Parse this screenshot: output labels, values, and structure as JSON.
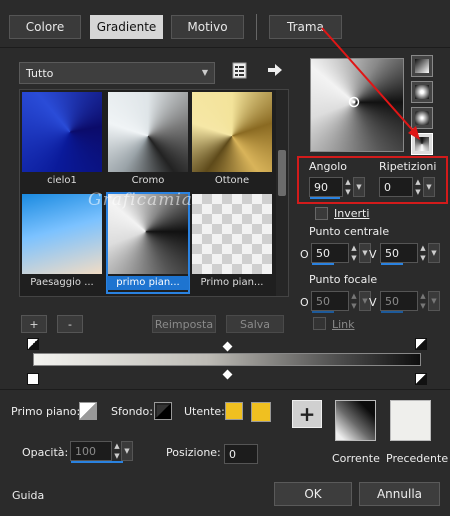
{
  "tabs": [
    {
      "label": "Colore"
    },
    {
      "label": "Gradiente"
    },
    {
      "label": "Motivo"
    },
    {
      "label": "Trama"
    }
  ],
  "dropdown": {
    "value": "Tutto"
  },
  "gradients": [
    {
      "label": "cielo1"
    },
    {
      "label": "Cromo"
    },
    {
      "label": "Ottone"
    },
    {
      "label": "Paesaggio ..."
    },
    {
      "label": "primo pian..."
    },
    {
      "label": "Primo pian..."
    }
  ],
  "watermark": "Graficamia",
  "buttons": {
    "add": "+",
    "remove": "-",
    "reset": "Reimposta",
    "save": "Salva"
  },
  "angle": {
    "label": "Angolo",
    "value": "90"
  },
  "repeats": {
    "label": "Ripetizioni",
    "value": "0"
  },
  "invert": {
    "label": "Inverti"
  },
  "center": {
    "label": "Punto centrale",
    "h_label": "O",
    "h_value": "50",
    "v_label": "V",
    "v_value": "50"
  },
  "focal": {
    "label": "Punto focale",
    "h_label": "O",
    "h_value": "50",
    "v_label": "V",
    "v_value": "50"
  },
  "link": {
    "label": "Link"
  },
  "color_row": {
    "foreground_label": "Primo piano:",
    "background_label": "Sfondo:",
    "user_label": "Utente:",
    "user_color": "#f0c020"
  },
  "opacity": {
    "label": "Opacità:",
    "value": "100"
  },
  "position": {
    "label": "Posizione:",
    "value": "0"
  },
  "current": {
    "label": "Corrente"
  },
  "previous": {
    "label": "Precedente"
  },
  "footer": {
    "help": "Guida",
    "ok": "OK",
    "cancel": "Annulla"
  },
  "colors": {
    "accent": "#2a82e0",
    "highlight": "#d31b1b",
    "selected_label_bg": "#1e74d0"
  }
}
